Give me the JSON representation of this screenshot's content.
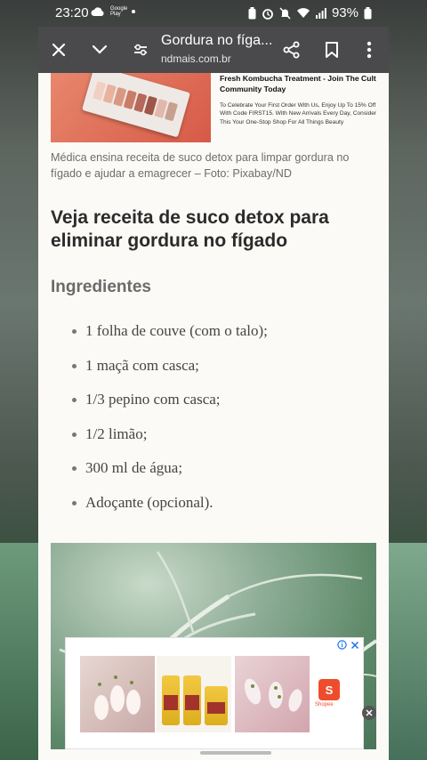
{
  "status_bar": {
    "time": "23:20",
    "left_icons": [
      "cloud-icon",
      "google-play-icon",
      "dot-icon"
    ],
    "google_play_label": "Google Play",
    "battery": "93%",
    "right_icons": [
      "battery-saver-icon",
      "alarm-icon",
      "mute-icon",
      "wifi-icon",
      "signal-icon",
      "battery-icon"
    ]
  },
  "toolbar": {
    "title": "Gordura no fíga...",
    "url": "ndmais.com.br",
    "icons": [
      "close-icon",
      "chevron-down-icon",
      "tune-icon",
      "share-icon",
      "bookmark-icon",
      "more-vert-icon"
    ]
  },
  "ad_top": {
    "title": "Fresh Kombucha Treatment - Join The Cult Community Today",
    "description": "To Celebrate Your First Order With Us, Enjoy Up To 15% Off With Code FIRST15. With New Arrivals Every Day, Consider This Your One-Stop Shop For All Things Beauty"
  },
  "article": {
    "caption": "Médica ensina receita de suco detox para limpar gordura no fígado e ajudar a emagrecer – Foto: Pixabay/ND",
    "heading": "Veja receita de suco detox para eliminar gordura no fígado",
    "subheading": "Ingredientes",
    "ingredients": [
      "1 folha de couve (com o talo);",
      "1 maçã com casca;",
      "1/3 pepino com casca;",
      "1/2 limão;",
      "300 ml de água;",
      "Adoçante (opcional)."
    ]
  },
  "bottom_ad": {
    "shop_label": "Shopee",
    "shop_letter": "S"
  },
  "colors": {
    "toolbar_bg": "#4a4a4c",
    "page_bg": "#fbfaf7",
    "heading": "#2b2b2b",
    "subheading": "#6b6b6b",
    "shopee": "#ee4d2d"
  }
}
